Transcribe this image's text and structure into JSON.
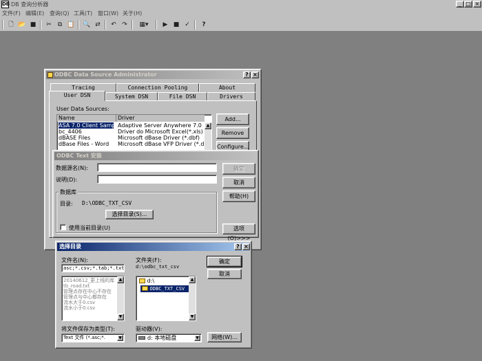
{
  "app": {
    "title": "DB 查询分析器",
    "icon_text": "DB"
  },
  "window_buttons": {
    "minimize": "_",
    "maximize": "□",
    "close": "×"
  },
  "menu": [
    "文件(F)",
    "编辑(E)",
    "查询(Q)",
    "工具(T)",
    "窗口(W)",
    "关于(H)"
  ],
  "odbc_admin": {
    "title": "ODBC Data Source Administrator",
    "help": "?",
    "close": "×",
    "tabs_back": [
      "Tracing",
      "Connection Pooling",
      "About"
    ],
    "tabs_front": [
      "User DSN",
      "System DSN",
      "File DSN",
      "Drivers"
    ],
    "section_label": "User Data Sources:",
    "columns": [
      "Name",
      "Driver"
    ],
    "rows": [
      {
        "name": "ASA 7.0 Client Sample",
        "driver": "Adaptive Server Anywhere 7.0"
      },
      {
        "name": "bc_4406",
        "driver": "Driver do Microsoft Excel(*.xls)"
      },
      {
        "name": "dBASE Files",
        "driver": "Microsoft dBase Driver (*.dbf)"
      },
      {
        "name": "dBase Files - Word",
        "driver": "Microsoft dBase VFP Driver (*.dbf)"
      }
    ],
    "buttons": {
      "add": "Add...",
      "remove": "Remove",
      "configure": "Configure..."
    }
  },
  "odbc_text": {
    "title": "ODBC Text 安装",
    "dsn_label": "数据源名(N):",
    "dsn_value": "",
    "desc_label": "说明(D):",
    "desc_value": "",
    "ok": "确定",
    "cancel": "取消",
    "help": "帮助(H)",
    "group_label": "数据库",
    "dir_label": "目录:",
    "dir_value": "D:\\ODBC_TXT_CSV",
    "select_dir": "选择目录(S)...",
    "use_current": "使用当前目录(U)",
    "options": "选项(O)>>>"
  },
  "choose_dir": {
    "title": "选择目录",
    "help": "?",
    "close": "×",
    "filename_label": "文件名(N):",
    "filename_value": "asc;*.csv;*.tab;*.txt",
    "files": [
      "20140612_更上线的库",
      "tb_road.txt",
      "管理点存在中心不存在",
      "管理点与中心都存在",
      "流水大于0.csv",
      "流水小于0.csv"
    ],
    "folder_label": "文件夹(F):",
    "folder_path": "d:\\odbc_txt_csv",
    "folders": [
      "d:\\",
      "ODBC_TXT_CSV"
    ],
    "ok": "确定",
    "cancel": "取消",
    "filetype_label": "将文件保存为类型(T):",
    "filetype_value": "Text 文件 (*.asc;*.",
    "drive_label": "驱动器(V):",
    "drive_value": "d: 本地磁盘",
    "network": "网络(W)..."
  }
}
